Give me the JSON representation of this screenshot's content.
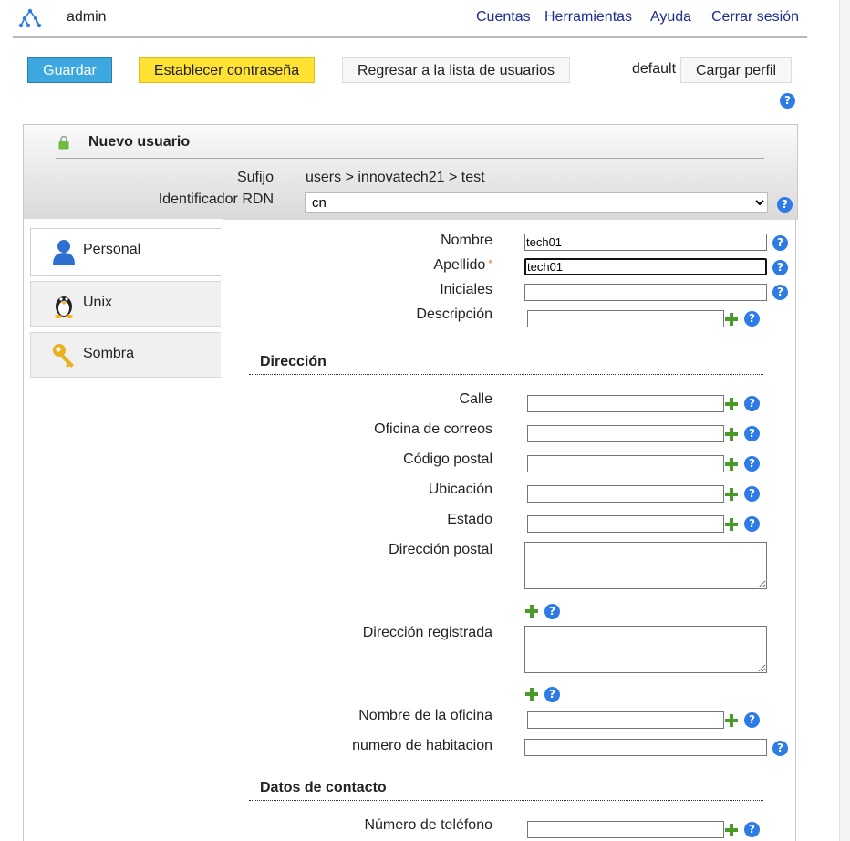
{
  "topbar": {
    "user": "admin",
    "nav": [
      "Cuentas",
      "Herramientas",
      "Ayuda",
      "Cerrar sesión"
    ]
  },
  "toolbar": {
    "save": "Guardar",
    "set_password": "Establecer contraseña",
    "back_to_list": "Regresar a la lista de usuarios",
    "profile_name": "default",
    "load_profile": "Cargar perfil"
  },
  "header": {
    "title": "Nuevo usuario",
    "suffix_label": "Sufijo",
    "suffix_value": "users > innovatech21 > test",
    "rdn_label": "Identificador RDN",
    "rdn_value": "cn"
  },
  "tabs": [
    "Personal",
    "Unix",
    "Sombra"
  ],
  "form": {
    "nombre": {
      "label": "Nombre",
      "value": "tech01"
    },
    "apellido": {
      "label": "Apellido",
      "value": "tech01",
      "required_mark": "*"
    },
    "iniciales": {
      "label": "Iniciales",
      "value": ""
    },
    "descripcion": {
      "label": "Descripción",
      "value": ""
    },
    "direccion_section": "Dirección",
    "calle": {
      "label": "Calle",
      "value": ""
    },
    "oficina_correos": {
      "label": "Oficina de correos",
      "value": ""
    },
    "codigo_postal": {
      "label": "Código postal",
      "value": ""
    },
    "ubicacion": {
      "label": "Ubicación",
      "value": ""
    },
    "estado": {
      "label": "Estado",
      "value": ""
    },
    "direccion_postal": {
      "label": "Dirección postal",
      "value": ""
    },
    "direccion_registrada": {
      "label": "Dirección registrada",
      "value": ""
    },
    "nombre_oficina": {
      "label": "Nombre de la oficina",
      "value": ""
    },
    "habitacion": {
      "label": "numero de habitacion",
      "value": ""
    },
    "contacto_section": "Datos de contacto",
    "telefono": {
      "label": "Número de teléfono",
      "value": ""
    }
  },
  "icons": {
    "help": "help-icon",
    "add": "add-icon",
    "lock": "lock-icon",
    "tabs": [
      "person-icon",
      "penguin-icon",
      "key-icon"
    ]
  },
  "colors": {
    "save": "#3da8e0",
    "set_password": "#ffe234",
    "nav_link": "#1c2e8f",
    "help": "#2f7be6",
    "add": "#4a9a2a",
    "required": "#e07b1a"
  }
}
